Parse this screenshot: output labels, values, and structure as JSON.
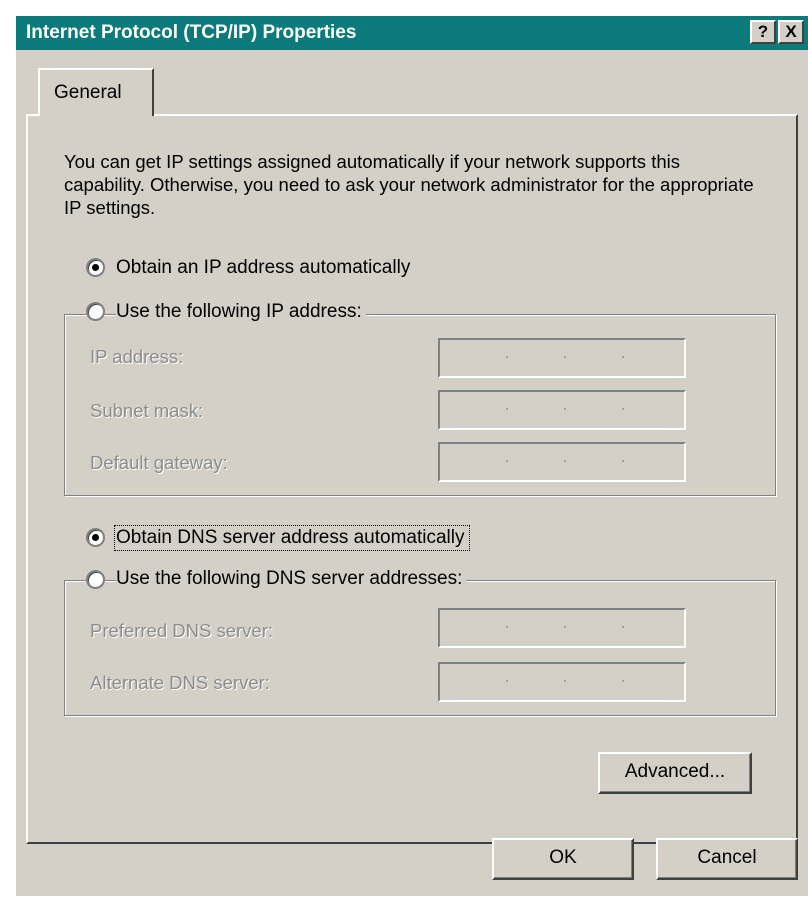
{
  "window": {
    "title": "Internet Protocol (TCP/IP) Properties",
    "help_glyph": "?",
    "close_glyph": "X"
  },
  "tabs": [
    {
      "label": "General"
    }
  ],
  "intro_text": "You can get IP settings assigned automatically if your network supports this capability. Otherwise, you need to ask your network administrator for the appropriate IP settings.",
  "ip": {
    "auto_label": "Obtain an IP address automatically",
    "auto_selected": true,
    "manual_label": "Use the following IP address:",
    "fields": [
      {
        "label": "IP address:",
        "value": ""
      },
      {
        "label": "Subnet mask:",
        "value": ""
      },
      {
        "label": "Default gateway:",
        "value": ""
      }
    ]
  },
  "dns": {
    "auto_label": "Obtain DNS server address automatically",
    "auto_selected": true,
    "manual_label": "Use the following DNS server addresses:",
    "fields": [
      {
        "label": "Preferred DNS server:",
        "value": ""
      },
      {
        "label": "Alternate DNS server:",
        "value": ""
      }
    ]
  },
  "buttons": {
    "advanced": "Advanced...",
    "ok": "OK",
    "cancel": "Cancel"
  },
  "colors": {
    "titlebar": "#0a7a7a",
    "face": "#d4d0c8",
    "disabled_text": "#8c8c8c"
  }
}
